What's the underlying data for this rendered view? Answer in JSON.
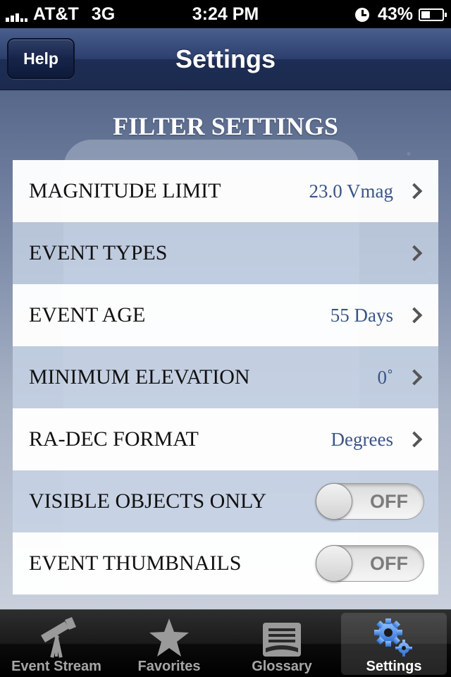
{
  "status_bar": {
    "carrier": "AT&T",
    "network": "3G",
    "time": "3:24 PM",
    "battery": "43%",
    "battery_level": 0.43
  },
  "nav": {
    "help_label": "Help",
    "title": "Settings"
  },
  "section": {
    "title": "FILTER SETTINGS"
  },
  "rows": [
    {
      "label": "MAGNITUDE LIMIT",
      "value": "23.0 Vmag"
    },
    {
      "label": "EVENT TYPES",
      "value": ""
    },
    {
      "label": "EVENT AGE",
      "value": "55 Days"
    },
    {
      "label": "MINIMUM ELEVATION",
      "value": "0˚"
    },
    {
      "label": "RA-DEC FORMAT",
      "value": "Degrees"
    }
  ],
  "toggles": [
    {
      "label": "VISIBLE OBJECTS ONLY",
      "state": "OFF"
    },
    {
      "label": "EVENT THUMBNAILS",
      "state": "OFF"
    }
  ],
  "tabs": [
    {
      "label": "Event Stream",
      "icon": "telescope-icon"
    },
    {
      "label": "Favorites",
      "icon": "star-icon"
    },
    {
      "label": "Glossary",
      "icon": "book-icon"
    },
    {
      "label": "Settings",
      "icon": "gears-icon"
    }
  ],
  "colors": {
    "nav_bar": "#2c3f6d",
    "value_text": "#3a5585",
    "settings_icon": "#4f8ce0"
  }
}
